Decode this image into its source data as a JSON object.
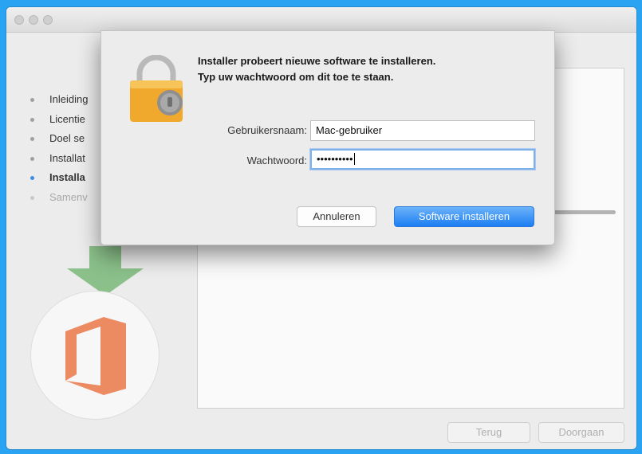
{
  "installer": {
    "steps": [
      {
        "label": "Inleiding",
        "state": "done"
      },
      {
        "label": "Licentie",
        "state": "done"
      },
      {
        "label": "Doel se",
        "state": "done"
      },
      {
        "label": "Installat",
        "state": "done"
      },
      {
        "label": "Installa",
        "state": "active"
      },
      {
        "label": "Samenv",
        "state": "pending"
      }
    ],
    "back_label": "Terug",
    "continue_label": "Doorgaan"
  },
  "dialog": {
    "message_line1": "Installer probeert nieuwe software te installeren.",
    "message_line2": "Typ uw wachtwoord om dit toe te staan.",
    "username_label": "Gebruikersnaam:",
    "username_value": "Mac-gebruiker",
    "password_label": "Wachtwoord:",
    "password_value": "••••••••••",
    "cancel_label": "Annuleren",
    "confirm_label": "Software installeren"
  },
  "colors": {
    "desktop_background": "#2aa4f2",
    "primary_button": "#1c7ef2",
    "office_logo": "#ec8a62",
    "download_arrow": "#8bc08a"
  },
  "icons": {
    "lock": "lock-icon",
    "download_arrow": "download-arrow-icon",
    "office_logo": "office-logo-icon"
  }
}
